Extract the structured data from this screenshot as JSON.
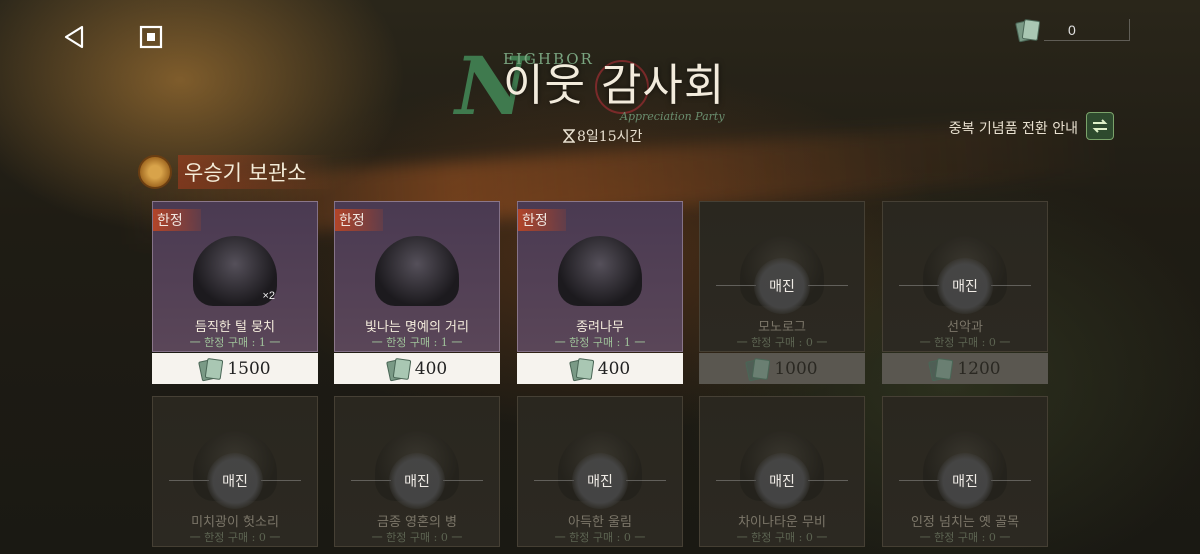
{
  "currency": {
    "amount": "0",
    "icon": "ticket-icon"
  },
  "event": {
    "brand_letter": "N",
    "brand_word": "EIGHBOR",
    "title": "이웃 감사회",
    "subtitle": "Appreciation Party",
    "timer": "8일15시간"
  },
  "dup_guide": {
    "label": "중복 기념품 전환 안내"
  },
  "section": {
    "title": "우승기 보관소"
  },
  "soldout_label": "매진",
  "limited_tag": "한정",
  "row1": [
    {
      "name": "듬직한 털 뭉치",
      "limit": "一 한정 구매 : 1 一",
      "price": "1500",
      "status": "limited",
      "mult": "×2"
    },
    {
      "name": "빛나는 명예의 거리",
      "limit": "一 한정 구매 : 1 一",
      "price": "400",
      "status": "limited",
      "mult": ""
    },
    {
      "name": "종려나무",
      "limit": "一 한정 구매 : 1 一",
      "price": "400",
      "status": "limited",
      "mult": ""
    },
    {
      "name": "모노로그",
      "limit": "一 한정 구매 : 0 一",
      "price": "1000",
      "status": "soldout",
      "mult": ""
    },
    {
      "name": "선악과",
      "limit": "一 한정 구매 : 0 一",
      "price": "1200",
      "status": "soldout",
      "mult": ""
    }
  ],
  "row2": [
    {
      "name": "미치광이 헛소리",
      "limit": "一 한정 구매 : 0 一",
      "status": "soldout"
    },
    {
      "name": "금종 영혼의 병",
      "limit": "一 한정 구매 : 0 一",
      "status": "soldout"
    },
    {
      "name": "아득한 울림",
      "limit": "一 한정 구매 : 0 一",
      "status": "soldout"
    },
    {
      "name": "차이나타운 무비",
      "limit": "一 한정 구매 : 0 一",
      "status": "soldout"
    },
    {
      "name": "인정 넘치는 옛 골목",
      "limit": "一 한정 구매 : 0 一",
      "status": "soldout"
    }
  ]
}
